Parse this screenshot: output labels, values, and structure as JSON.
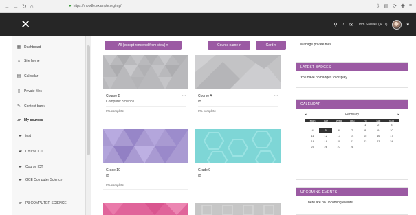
{
  "browser": {
    "url": "https://moodle.example.org/my/",
    "nav_icons": [
      "back-icon",
      "forward-icon",
      "reload-icon",
      "home-icon"
    ]
  },
  "navbar": {
    "close_glyph": "✕",
    "username": "Tom Sallwell (ACT)",
    "icons": [
      "search-icon",
      "bell-icon",
      "chat-icon"
    ]
  },
  "sidebar": {
    "items": [
      {
        "label": "Dashboard",
        "icon": "dashboard-icon"
      },
      {
        "label": "Site home",
        "icon": "home-icon"
      },
      {
        "label": "Calendar",
        "icon": "calendar-icon"
      },
      {
        "label": "Private files",
        "icon": "file-icon"
      },
      {
        "label": "Content bank",
        "icon": "pencil-icon"
      },
      {
        "label": "My courses",
        "icon": "graduation-cap-icon"
      },
      {
        "label": "test",
        "icon": "graduation-cap-icon"
      },
      {
        "label": "Course ICT",
        "icon": "graduation-cap-icon"
      },
      {
        "label": "Course ICT",
        "icon": "graduation-cap-icon"
      },
      {
        "label": "GCE Computer Science",
        "icon": "graduation-cap-icon"
      },
      {
        "label": "P3 COMPUTER SCIENCE",
        "icon": "graduation-cap-icon"
      }
    ]
  },
  "main": {
    "filter_button": "All (except removed from view) ▾",
    "sort_button": "Course name ▾",
    "view_button": "Card ▾",
    "courses": [
      {
        "name": "Course B",
        "sub": "Computer Science",
        "meta": "0% complete"
      },
      {
        "name": "Course A",
        "sub": "IB",
        "meta": "0% complete"
      },
      {
        "name": "Grade 10",
        "sub": "IB",
        "meta": "0% complete"
      },
      {
        "name": "Grade 9",
        "sub": "IB",
        "meta": ""
      }
    ],
    "menu_glyph": "⋯"
  },
  "right": {
    "manage_text": "Manage private files...",
    "badges_title": "LATEST BADGES",
    "badges_text": "You have no badges to display",
    "calendar_title": "CALENDAR",
    "calendar_month": "February",
    "calendar_prev": "◂",
    "calendar_next": "▸",
    "calendar_days": [
      "Mon",
      "Tue",
      "Wed",
      "Thu",
      "Fri",
      "Sat",
      "Sun"
    ],
    "calendar_weeks": [
      [
        "",
        "",
        "",
        "",
        "1",
        "2",
        "3"
      ],
      [
        "4",
        "5",
        "6",
        "7",
        "8",
        "9",
        "10"
      ],
      [
        "11",
        "12",
        "13",
        "14",
        "15",
        "16",
        "17"
      ],
      [
        "18",
        "19",
        "20",
        "21",
        "22",
        "23",
        "24"
      ],
      [
        "25",
        "26",
        "27",
        "28",
        "",
        "",
        ""
      ]
    ],
    "calendar_today": "5",
    "upcoming_title": "UPCOMING EVENTS",
    "upcoming_text": "There are no upcoming events"
  },
  "colors": {
    "accent": "#9b5aa3",
    "navbar": "#262626"
  }
}
